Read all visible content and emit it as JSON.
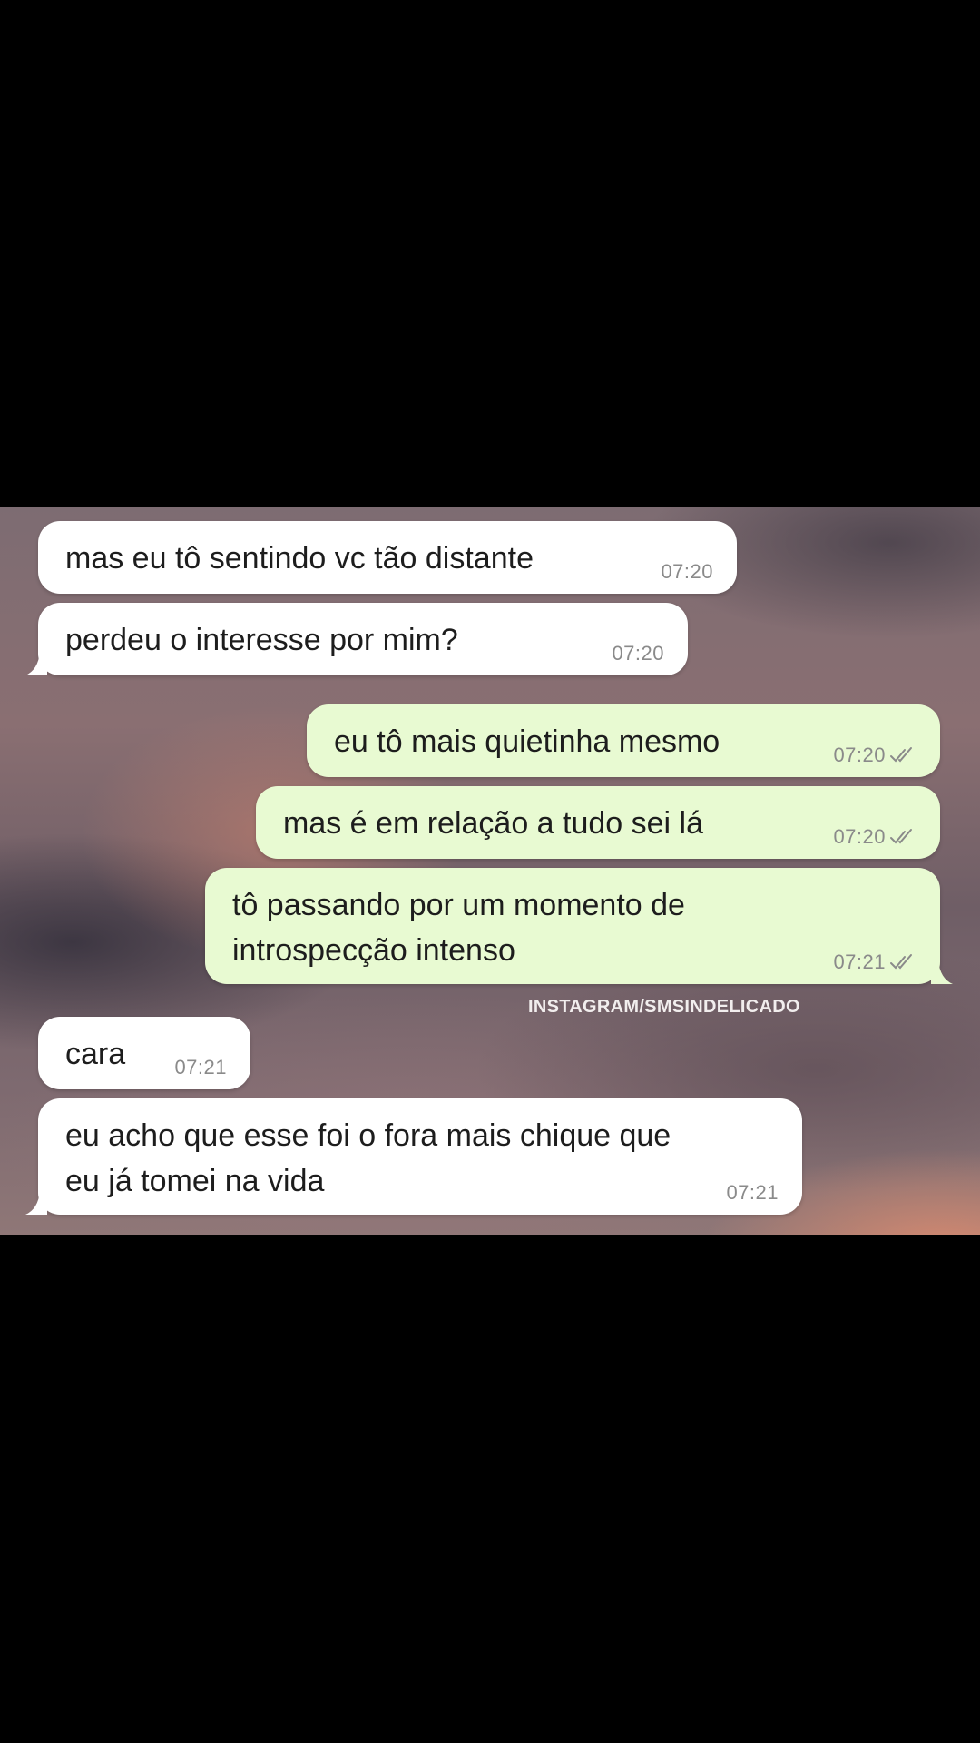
{
  "messages": [
    {
      "text": "mas eu tô sentindo vc tão distante",
      "time": "07:20"
    },
    {
      "text": "perdeu o interesse por mim?",
      "time": "07:20"
    },
    {
      "text": "eu tô mais quietinha mesmo",
      "time": "07:20"
    },
    {
      "text": "mas é em relação a tudo sei lá",
      "time": "07:20"
    },
    {
      "text": "tô passando por um momento de\nintrospecção intenso",
      "time": "07:21"
    },
    {
      "text": "cara",
      "time": "07:21"
    },
    {
      "text": "eu acho que esse foi o fora mais chique que\neu já tomei na vida",
      "time": "07:21"
    }
  ],
  "watermark": "INSTAGRAM/SMSINDELICADO",
  "colors": {
    "incoming_bubble": "#ffffff",
    "outgoing_bubble": "#e8fad2",
    "timestamp": "#8a8a8a",
    "background": "#000000"
  },
  "icons": {
    "read_receipt": "double-check-icon"
  }
}
